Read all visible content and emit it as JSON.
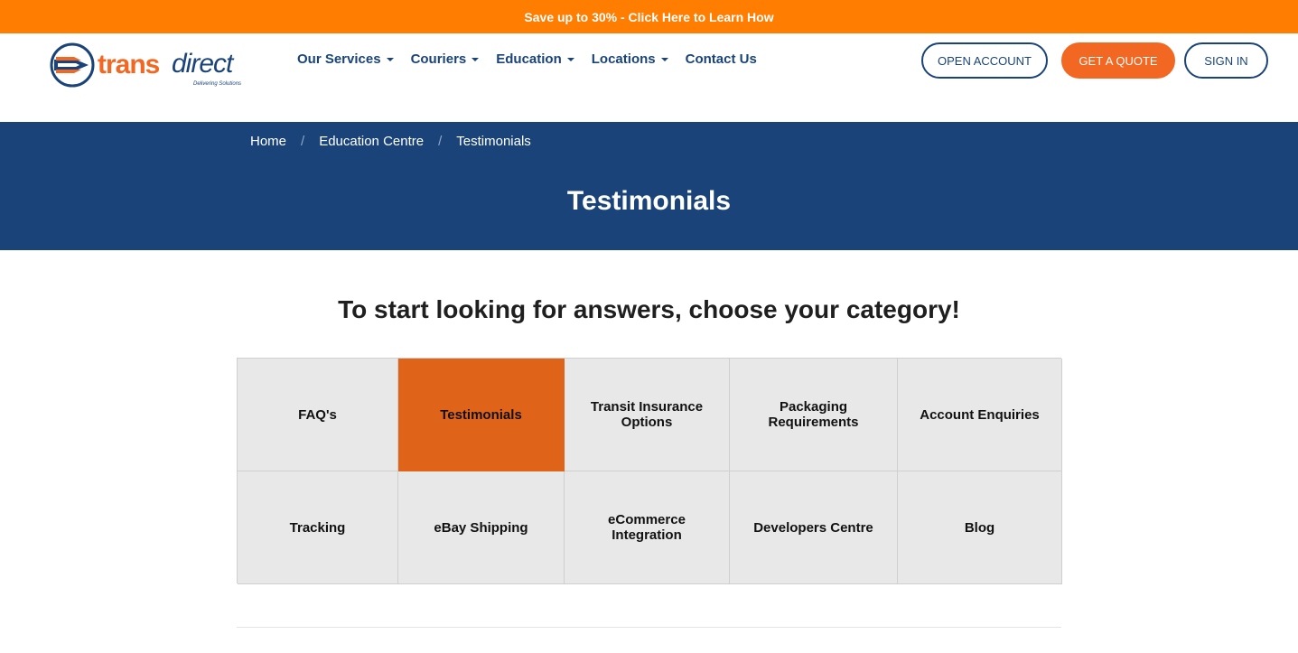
{
  "promo": {
    "text": "Save up to 30% - Click Here to Learn How"
  },
  "brand": {
    "word1": "trans",
    "word2": "direct",
    "tagline": "Delivering Solutions"
  },
  "nav": {
    "items": [
      {
        "label": "Our Services",
        "dropdown": true
      },
      {
        "label": "Couriers",
        "dropdown": true
      },
      {
        "label": "Education",
        "dropdown": true
      },
      {
        "label": "Locations",
        "dropdown": true
      },
      {
        "label": "Contact Us",
        "dropdown": false
      }
    ]
  },
  "actions": {
    "open_account": "OPEN ACCOUNT",
    "get_quote": "GET A QUOTE",
    "sign_in": "SIGN IN"
  },
  "breadcrumb": {
    "items": [
      "Home",
      "Education Centre",
      "Testimonials"
    ],
    "separator": "/"
  },
  "hero": {
    "title": "Testimonials"
  },
  "headline": "To start looking for answers, choose your category!",
  "categories": [
    {
      "label": "FAQ's",
      "active": false
    },
    {
      "label": "Testimonials",
      "active": true
    },
    {
      "label": "Transit Insurance Options",
      "active": false
    },
    {
      "label": "Packaging Requirements",
      "active": false
    },
    {
      "label": "Account Enquiries",
      "active": false
    },
    {
      "label": "Tracking",
      "active": false
    },
    {
      "label": "eBay Shipping",
      "active": false
    },
    {
      "label": "eCommerce Integration",
      "active": false
    },
    {
      "label": "Developers Centre",
      "active": false
    },
    {
      "label": "Blog",
      "active": false
    }
  ],
  "colors": {
    "orange": "#ff7d00",
    "brand_orange": "#f26722",
    "navy": "#1a4479",
    "active_tile": "#e0631a",
    "tile": "#e8e8e8"
  }
}
